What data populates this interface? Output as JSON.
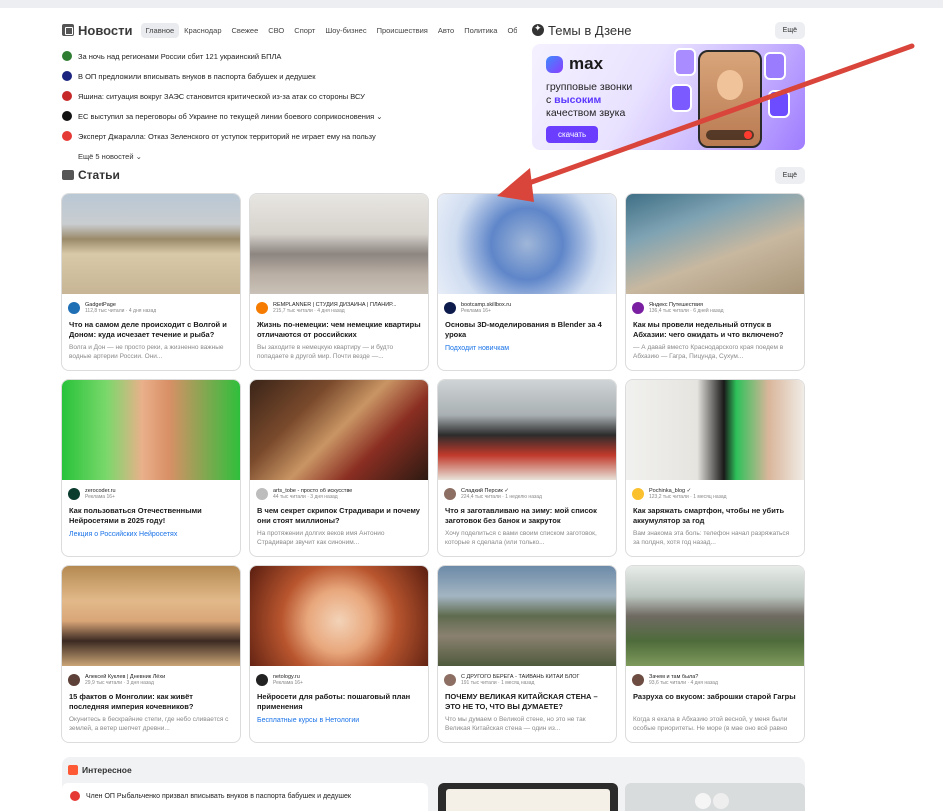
{
  "news": {
    "title": "Новости",
    "tabs": [
      "Главное",
      "Краснодар",
      "Свежее",
      "СВО",
      "Спорт",
      "Шоу-бизнес",
      "Происшествия",
      "Авто",
      "Политика",
      "Общ"
    ],
    "tabs_arrow": "›",
    "items": [
      {
        "text": "За ночь над регионами России сбит 121 украинский БПЛА",
        "source_color": "#2e7d32"
      },
      {
        "text": "В ОП предложили вписывать внуков в паспорта бабушек и дедушек",
        "source_color": "#1a237e"
      },
      {
        "text": "Яшина: ситуация вокруг ЗАЭС становится критической из-за атак со стороны ВСУ",
        "source_color": "#c62828"
      },
      {
        "text": "ЕС выступил за переговоры об Украине по текущей линии боевого соприкосновения ⌄",
        "source_color": "#111111"
      },
      {
        "text": "Эксперт Джаралла: Отказ Зеленского от уступок территорий не играет ему на пользу",
        "source_color": "#e53935"
      }
    ],
    "more": "Ещё 5 новостей ⌄"
  },
  "zen": {
    "title": "Темы в Дзене",
    "more": "Ещё",
    "banner": {
      "logo": "max",
      "line1": "групповые звонки",
      "line2_prefix": "с ",
      "line2_bold": "высоким",
      "line3": "качеством звука",
      "button": "скачать"
    }
  },
  "articles": {
    "title": "Статьи",
    "more": "Ещё",
    "cards": [
      {
        "publisher": "GadgetPage",
        "stat": "112,8 тыс читали · 4 дня назад",
        "title": "Что на самом деле происходит с Волгой и Доном: куда исчезает течение и рыба?",
        "desc": "Волга и Дон — не просто реки, а жизненно важные водные артерии России. Они...",
        "link": "",
        "thumb": "linear-gradient(180deg,#b9c7d4 0%,#c9cdd0 30%,#9a8a6a 45%,#d8c9a8 60%,#c7b596 100%)",
        "ava": "#1f6fb5"
      },
      {
        "publisher": "REMPLANNER | СТУДИЯ ДИЗАЙНА | ПЛАНИР...",
        "stat": "215,7 тыс читали · 4 дня назад",
        "title": "Жизнь по-немецки: чем немецкие квартиры отличаются от российских",
        "desc": "Вы заходите в немецкую квартиру — и будто попадаете в другой мир. Почти везде —...",
        "link": "",
        "thumb": "linear-gradient(180deg,#e8e6e2 0%,#d6d2cc 40%,#8c8580 60%,#b9aea3 80%,#c9c1b7 100%)",
        "ava": "#f57c00"
      },
      {
        "publisher": "bootcamp.skillbox.ru",
        "stat": "Реклама 16+",
        "title": "Основы 3D-моделирования в Blender за 4 урока",
        "desc": "",
        "link": "Подходит новичкам",
        "thumb": "radial-gradient(circle at 50% 50%,#9fb6d8 0%,#5f86c9 35%,#cfdcf0 70%,#e8eef8 100%)",
        "ava": "#0d1b4c"
      },
      {
        "publisher": "Яндекс Путешествия",
        "stat": "136,4 тыс читали · 6 дней назад",
        "title": "Как мы провели недельный отпуск в Абхазии: чего ожидать и что включено?",
        "desc": "— А давай вместо Краснодарского края поедем в Абхазию — Гагра, Пицунда, Сухум...",
        "link": "",
        "thumb": "linear-gradient(160deg,#3f6f86 0%,#7fa3b3 30%,#c8b8a0 60%,#a99679 100%)",
        "ava": "#7b1fa2"
      },
      {
        "publisher": "zerocoder.ru",
        "stat": "Реклама 16+",
        "title": "Как пользоваться Отечественными Нейросетями в 2025 году!",
        "desc": "",
        "link": "Лекция о Российских Нейросетях",
        "thumb": "linear-gradient(90deg,#28c23a 0%,#7ad86b 25%,#e9b08a 45%,#d98f66 60%,#2fbf3c 100%)",
        "ava": "#0b3d2e"
      },
      {
        "publisher": "arts_tobe - просто об искусстве",
        "stat": "44 тыс читали · 3 дня назад",
        "title": "В чем секрет скрипок Страдивари и почему они стоят миллионы?",
        "desc": "На протяжении долгих веков имя Антонио Страдивари звучит как синоним...",
        "link": "",
        "thumb": "linear-gradient(135deg,#3a2418 0%,#7a4a2c 30%,#c99564 50%,#8a2e22 70%,#2c1a12 100%)",
        "ava": "#bdbdbd"
      },
      {
        "publisher": "Сладкий Персик ✓",
        "stat": "224,4 тыс читали · 1 неделю назад",
        "title": "Что я заготавливаю на зиму: мой список заготовок без банок и закруток",
        "desc": "Хочу поделиться с вами своим списком заготовок, которые я сделала (или только...",
        "link": "",
        "thumb": "linear-gradient(180deg,#cfd4d6 0%,#a9b0b3 35%,#2c2c2c 55%,#c0392b 75%,#e8e2da 100%)",
        "ava": "#8d6e63"
      },
      {
        "publisher": "Pochinka_blog ✓",
        "stat": "123,2 тыс читали · 1 месяц назад",
        "title": "Как заряжать смартфон, чтобы не убить аккумулятор за год",
        "desc": "Вам знакома эта боль: телефон начал разряжаться за полдня, хотя год назад...",
        "link": "",
        "thumb": "linear-gradient(90deg,#f1f1ef 0%,#e6e4df 40%,#1a1a1a 55%,#2ec15a 62%,#d9b59a 80%,#f0ece6 100%)",
        "ava": "#fbc02d"
      },
      {
        "publisher": "Алексей Куклев | Дневник Лёхи",
        "stat": "29,9 тыс читали · 3 дня назад",
        "title": "15 фактов о Монголии: как живёт последняя империя кочевников?",
        "desc": "Окунитесь в бескрайние степи, где небо сливается с землей, а ветер шепчет древни...",
        "link": "",
        "thumb": "linear-gradient(180deg,#b58a52 0%,#e2b98a 35%,#d9a678 55%,#3b2a22 75%,#caa476 100%)",
        "ava": "#5d4037"
      },
      {
        "publisher": "netology.ru",
        "stat": "Реклама 16+",
        "title": "Нейросети для работы: пошаговый план применения",
        "desc": "",
        "link": "Бесплатные курсы в Нетологии",
        "thumb": "radial-gradient(circle at 50% 55%,#f3d3b8 0%,#e8a77c 30%,#b8552e 55%,#5a1e10 100%)",
        "ava": "#222222"
      },
      {
        "publisher": "С ДРУГОГО БЕРЕГА - ТАЙВАНЬ КИТАЙ БЛОГ",
        "stat": "191 тыс читали · 1 месяц назад",
        "title": "ПОЧЕМУ ВЕЛИКАЯ КИТАЙСКАЯ СТЕНА – ЭТО НЕ ТО, ЧТО ВЫ ДУМАЕТЕ?",
        "desc": "Что мы думаем о Великой стене, но это не так Великая Китайская стена — один из...",
        "link": "",
        "thumb": "linear-gradient(180deg,#6c8aa8 0%,#a3b5c2 30%,#5f6b4e 50%,#8a8170 70%,#4f5a3c 100%)",
        "ava": "#8d6e63"
      },
      {
        "publisher": "Зачем и там была?",
        "stat": "93,6 тыс читали · 4 дня назад",
        "title": "Разруха со вкусом: заброшки старой Гагры",
        "desc": "Когда я ехала в Абхазию этой весной, у меня были особые приоритеты. Не море (в мае оно всё равно холодное) и не природные...",
        "link": "",
        "thumb": "linear-gradient(180deg,#e7ece9 0%,#bcc6c0 30%,#6f6a62 50%,#4e6b3b 75%,#7f9a5c 100%)",
        "ava": "#6d4c41"
      }
    ]
  },
  "interesting": {
    "title": "Интересное",
    "news": "Член ОП Рыбальченко призвал вписывать внуков в паспорта бабушек и дедушек"
  },
  "annotation": {
    "arrow_color": "#d9453a"
  }
}
